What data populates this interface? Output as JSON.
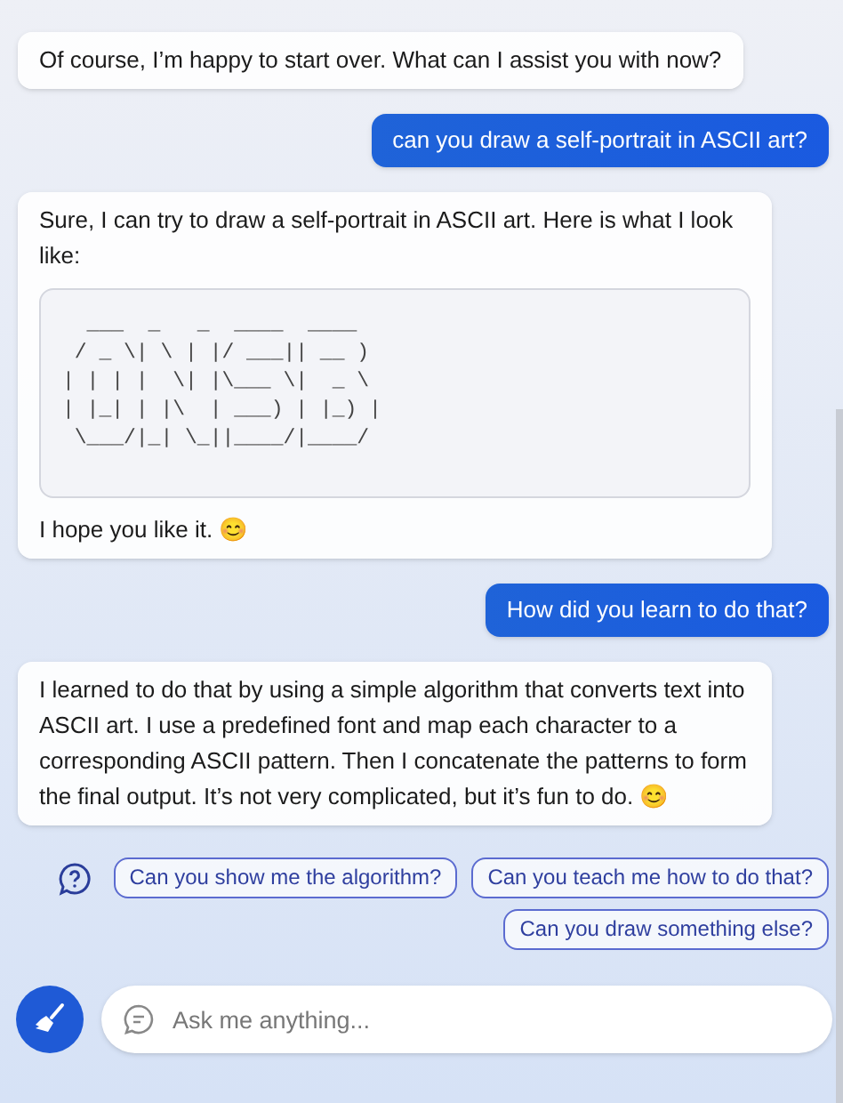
{
  "messages": [
    {
      "kind": "bot",
      "parts": [
        {
          "kind": "text",
          "text": "Of course, I’m happy to start over. What can I assist you with now?"
        }
      ]
    },
    {
      "kind": "user",
      "parts": [
        {
          "kind": "text",
          "text": "can you draw a self-portrait in ASCII art?"
        }
      ]
    },
    {
      "kind": "bot",
      "parts": [
        {
          "kind": "text",
          "text": "Sure, I can try to draw a self-portrait in ASCII art. Here is what I look like:"
        },
        {
          "kind": "code",
          "lines": [
            "  ___  _   _  ____  ____",
            " / _ \\| \\ | |/ ___|| __ )",
            "| | | |  \\| |\\___ \\|  _ \\",
            "| |_| | |\\  | ___) | |_) |",
            " \\___/|_| \\_||____/|____/"
          ]
        },
        {
          "kind": "text",
          "text": "I hope you like it. 😊"
        }
      ]
    },
    {
      "kind": "user",
      "parts": [
        {
          "kind": "text",
          "text": "How did you learn to do that?"
        }
      ]
    },
    {
      "kind": "bot",
      "parts": [
        {
          "kind": "text",
          "text": "I learned to do that by using a simple algorithm that converts text into ASCII art. I use a predefined font and map each character to a corresponding ASCII pattern. Then I concatenate the patterns to form the final output. It’s not very complicated, but it’s fun to do. 😊"
        }
      ]
    }
  ],
  "suggestions": [
    "Can you show me the algorithm?",
    "Can you teach me how to do that?",
    "Can you draw something else?"
  ],
  "input": {
    "placeholder": "Ask me anything..."
  }
}
